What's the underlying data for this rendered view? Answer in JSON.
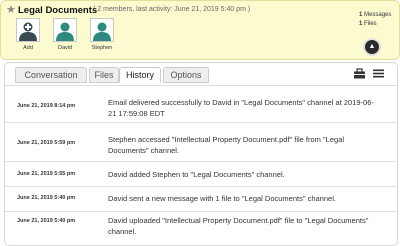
{
  "channel": {
    "title": "Legal Documents",
    "meta": "( 2 members, last activity: June 21, 2019 5:40 pm )",
    "members": [
      {
        "label": "Add",
        "icon": "add-user-icon"
      },
      {
        "label": "David",
        "icon": "user-avatar-icon"
      },
      {
        "label": "Stephen",
        "icon": "user-avatar-icon"
      }
    ],
    "stats": {
      "messages_count": "1",
      "messages_label": "Messages",
      "files_count": "1",
      "files_label": "Files"
    },
    "collapse_icon": "chevron-up-icon"
  },
  "tabs": [
    {
      "label": "Conversation"
    },
    {
      "label": "Files"
    },
    {
      "label": "History",
      "active": true
    },
    {
      "label": "Options"
    }
  ],
  "toolbar": {
    "icons": [
      "briefcase-icon",
      "menu-icon"
    ]
  },
  "history": [
    {
      "date": "June 21, 2019 8:14 pm",
      "text": "Email delivered successfully to David in \"Legal Documents\" channel at 2019-06-21 17:59:08 EDT"
    },
    {
      "date": "June 21, 2019 5:59 pm",
      "text": "Stephen accessed \"Intellectual Property Document.pdf\" file from \"Legal Documents\" channel."
    },
    {
      "date": "June 21, 2019 5:55 pm",
      "text": "David added Stephen to \"Legal Documents\" channel."
    },
    {
      "date": "June 21, 2019 5:40 pm",
      "text": "David sent a new message with 1 file to \"Legal Documents\" channel."
    },
    {
      "date": "June 21, 2019 5:40 pm",
      "text": "David uploaded \"Intellectual Property Document.pdf\" file to \"Legal Documents\" channel."
    }
  ],
  "colors": {
    "header_bg": "#fcfbd0",
    "avatar_dark": "#3a4a55",
    "avatar_teal": "#2e8a7e"
  }
}
